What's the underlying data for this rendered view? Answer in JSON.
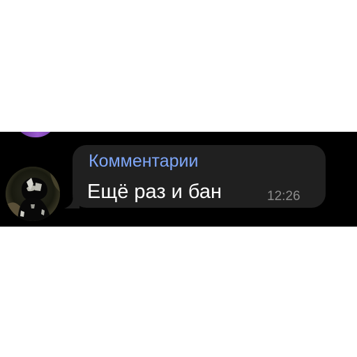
{
  "message": {
    "sender": "Комментарии",
    "text": "Ещё раз и бан",
    "time": "12:26",
    "avatar_icon": "user-photo-avatar"
  },
  "colors": {
    "background": "#000000",
    "bubble": "#202020",
    "sender_name": "#7ea6f8",
    "message_text": "#ffffff",
    "timestamp": "#8c8c8c",
    "previous_avatar": "#8a4fc4"
  }
}
